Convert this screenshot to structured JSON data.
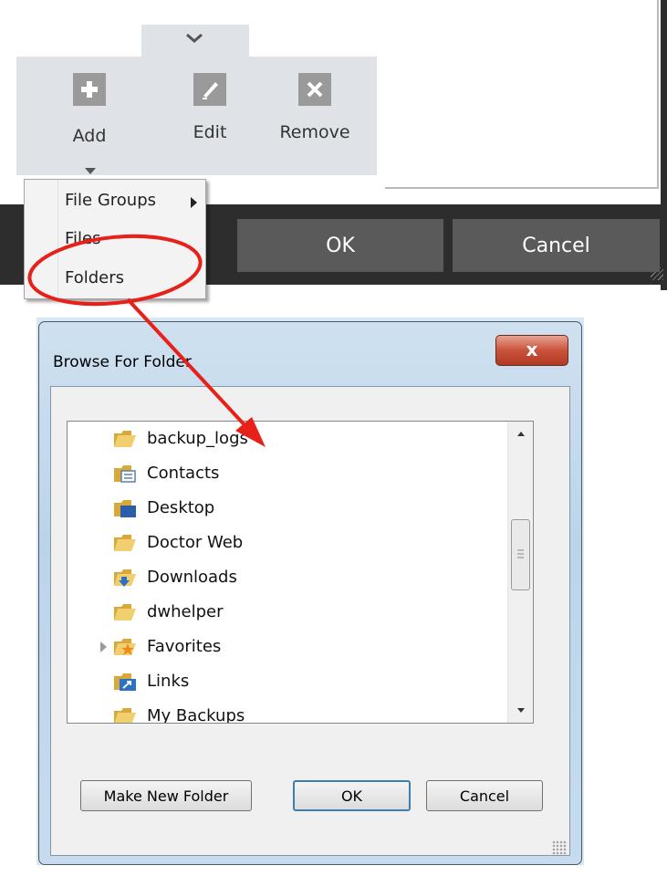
{
  "toolbar": {
    "add_label": "Add",
    "edit_label": "Edit",
    "remove_label": "Remove"
  },
  "add_menu": {
    "items": [
      {
        "label": "File Groups"
      },
      {
        "label": "Files"
      },
      {
        "label": "Folders"
      }
    ]
  },
  "footer_bar": {
    "ok_label": "OK",
    "cancel_label": "Cancel"
  },
  "annotation_color": "#e8201a",
  "dialog": {
    "title": "Browse For Folder",
    "close_glyph": "x",
    "tree_items": [
      {
        "label": "backup_logs",
        "icon": "folder-icon"
      },
      {
        "label": "Contacts",
        "icon": "contacts-folder-icon"
      },
      {
        "label": "Desktop",
        "icon": "desktop-folder-icon"
      },
      {
        "label": "Doctor Web",
        "icon": "folder-icon"
      },
      {
        "label": "Downloads",
        "icon": "downloads-folder-icon"
      },
      {
        "label": "dwhelper",
        "icon": "folder-icon"
      },
      {
        "label": "Favorites",
        "icon": "favorites-folder-icon"
      },
      {
        "label": "Links",
        "icon": "links-folder-icon"
      },
      {
        "label": "My Backups",
        "icon": "folder-icon"
      }
    ],
    "buttons": {
      "make_new_folder": "Make New Folder",
      "ok": "OK",
      "cancel": "Cancel"
    }
  }
}
